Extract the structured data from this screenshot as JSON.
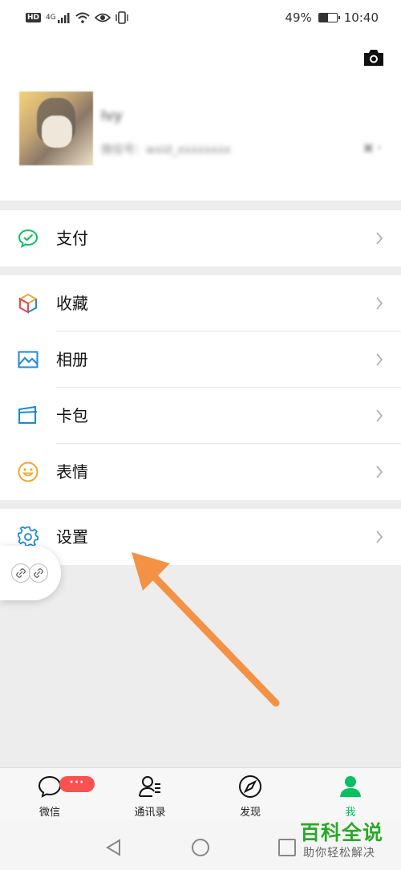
{
  "status_bar": {
    "hd": "HD",
    "network": "4G",
    "battery_text": "49%",
    "battery_level": 0.49,
    "time": "10:40"
  },
  "profile": {
    "camera_icon": "camera-icon",
    "nickname": "Ivy",
    "wechat_id": "微信号：wxid_xxxxxxxx",
    "tail_icons": "▣ ›"
  },
  "menu": {
    "pay": {
      "label": "支付",
      "icon": "wechat-pay-icon",
      "color": "#07c160"
    },
    "favorites": {
      "label": "收藏",
      "icon": "cube-icon"
    },
    "album": {
      "label": "相册",
      "icon": "image-icon",
      "color": "#1a8ad6"
    },
    "cards": {
      "label": "卡包",
      "icon": "wallet-icon",
      "color": "#1a8ad6"
    },
    "stickers": {
      "label": "表情",
      "icon": "smiley-icon",
      "color": "#f0a830"
    },
    "settings": {
      "label": "设置",
      "icon": "gear-icon",
      "color": "#1a8ad6"
    }
  },
  "tabbar": {
    "chats": {
      "label": "微信",
      "badge": "···"
    },
    "contacts": {
      "label": "通讯录"
    },
    "discover": {
      "label": "发现"
    },
    "me": {
      "label": "我",
      "color": "#07c160"
    }
  },
  "watermark": {
    "title": "百科全说",
    "subtitle": "助你轻松解决"
  },
  "colors": {
    "accent": "#07c160",
    "arrow": "#f39244",
    "badge": "#fa5151"
  }
}
